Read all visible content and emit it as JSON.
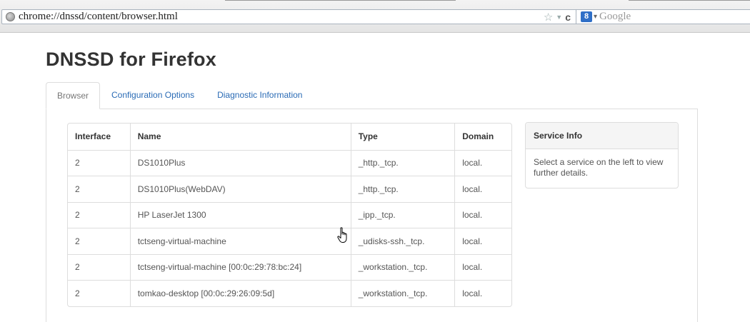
{
  "browser": {
    "url": "chrome://dnssd/content/browser.html",
    "search_placeholder": "Google",
    "search_engine_letter": "8"
  },
  "page": {
    "title": "DNSSD for Firefox"
  },
  "tabs": [
    {
      "label": "Browser",
      "active": true
    },
    {
      "label": "Configuration Options",
      "active": false
    },
    {
      "label": "Diagnostic Information",
      "active": false
    }
  ],
  "table": {
    "headers": [
      "Interface",
      "Name",
      "Type",
      "Domain"
    ],
    "rows": [
      [
        "2",
        "DS1010Plus",
        "_http._tcp.",
        "local."
      ],
      [
        "2",
        "DS1010Plus(WebDAV)",
        "_http._tcp.",
        "local."
      ],
      [
        "2",
        "HP LaserJet 1300",
        "_ipp._tcp.",
        "local."
      ],
      [
        "2",
        "tctseng-virtual-machine",
        "_udisks-ssh._tcp.",
        "local."
      ],
      [
        "2",
        "tctseng-virtual-machine [00:0c:29:78:bc:24]",
        "_workstation._tcp.",
        "local."
      ],
      [
        "2",
        "tomkao-desktop [00:0c:29:26:09:5d]",
        "_workstation._tcp.",
        "local."
      ]
    ]
  },
  "service_info": {
    "heading": "Service Info",
    "body": "Select a service on the left to view further details."
  },
  "colors": {
    "link": "#2a6bb5",
    "border": "#dddddd",
    "panel_heading_bg": "#f5f5f5"
  }
}
